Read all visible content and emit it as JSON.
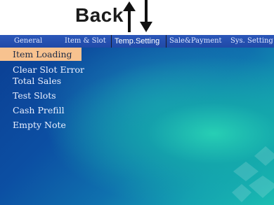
{
  "header": {
    "back_label": "Back"
  },
  "tabs": {
    "general": "General",
    "item_slot": "Item & Slot",
    "temp_setting": "Temp.Setting",
    "sale_payment": "Sale&Payment",
    "sys_setting": "Sys. Setting"
  },
  "menu": {
    "items": [
      {
        "label": "Item Loading",
        "selected": true
      },
      {
        "label": "Clear Slot Error",
        "selected": false
      },
      {
        "label": "Total Sales",
        "selected": false
      },
      {
        "label": "Test Slots",
        "selected": false
      },
      {
        "label": "Cash Prefill",
        "selected": false
      },
      {
        "label": "Empty Note",
        "selected": false
      }
    ]
  },
  "colors": {
    "selected_item_bg": "#f7c28f",
    "tabbar_bg": "#2b57b9",
    "screen_gradient_start": "#0b3e92",
    "screen_gradient_end": "#1bbfb2"
  },
  "icons": {
    "up": "arrow-up-icon",
    "down": "arrow-down-icon"
  }
}
